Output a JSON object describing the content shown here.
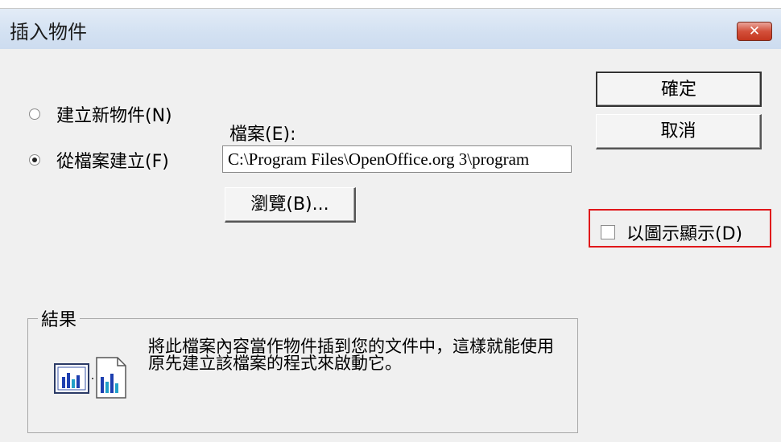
{
  "dialog": {
    "title": "插入物件",
    "close_label": "✕"
  },
  "options": {
    "create_new": {
      "label": "建立新物件(N)",
      "checked": false
    },
    "from_file": {
      "label": "從檔案建立(F)",
      "checked": true
    }
  },
  "file": {
    "label": "檔案(E):",
    "value": "C:\\Program Files\\OpenOffice.org 3\\program"
  },
  "buttons": {
    "browse": "瀏覽(B)...",
    "ok": "確定",
    "cancel": "取消"
  },
  "display_as_icon": {
    "label": "以圖示顯示(D)",
    "checked": false,
    "highlight_color": "#e0171a"
  },
  "result": {
    "title": "結果",
    "text": "將此檔案內容當作物件插到您的文件中，這樣就能使用原先建立該檔案的程式來啟動它。",
    "icon": "embedded-document-icon"
  }
}
